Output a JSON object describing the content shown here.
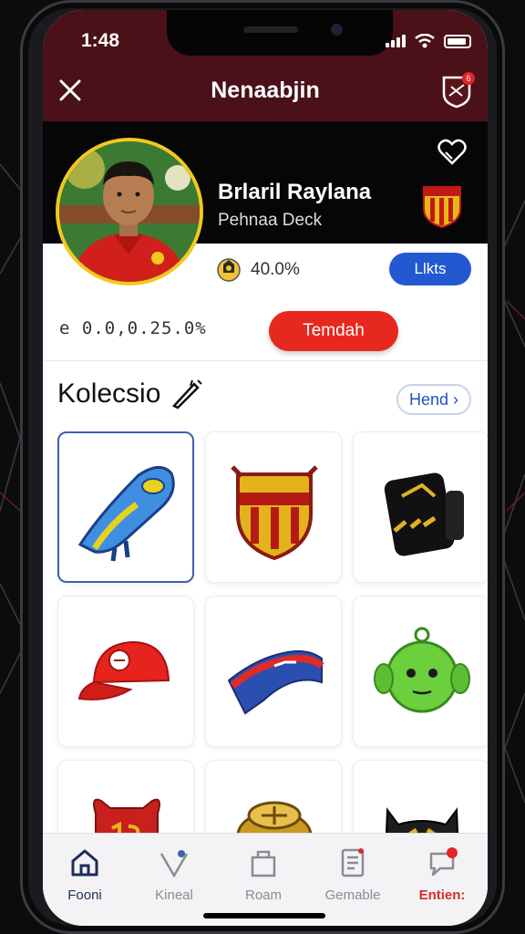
{
  "status_bar": {
    "time": "1:48"
  },
  "header": {
    "title": "Nenaabjin",
    "close_icon": "close-icon",
    "club_icon": "club-badge-icon",
    "badge_count": "6"
  },
  "profile": {
    "name": "Brlaril Raylana",
    "subtitle": "Pehnaa Deck",
    "stat_value": "40.0%",
    "likes_label": "Llkts",
    "price": "е 0.0,0.25.0%",
    "buy_label": "Temdah"
  },
  "collection": {
    "title": "Kolecsio",
    "more_label": "Hend",
    "items": [
      {
        "name": "blue-boot-icon",
        "selected": true
      },
      {
        "name": "crest-shield-icon",
        "selected": false
      },
      {
        "name": "armband-icon",
        "selected": false
      },
      {
        "name": "red-cap-icon",
        "selected": false
      },
      {
        "name": "scarf-icon",
        "selected": false
      },
      {
        "name": "green-mascot-icon",
        "selected": false
      },
      {
        "name": "red-trophy-icon",
        "selected": false
      },
      {
        "name": "gold-ring-icon",
        "selected": false
      },
      {
        "name": "black-mask-icon",
        "selected": false
      }
    ]
  },
  "tabbar": {
    "tabs": [
      {
        "label": "Fooni",
        "icon": "home-icon",
        "active": true
      },
      {
        "label": "Kineal",
        "icon": "heart-pin-icon",
        "active": false
      },
      {
        "label": "Roam",
        "icon": "bag-icon",
        "active": false
      },
      {
        "label": "Gemable",
        "icon": "document-icon",
        "active": false
      },
      {
        "label": "Entien:",
        "icon": "chat-alert-icon",
        "active": false
      }
    ]
  },
  "colors": {
    "header_bg": "#4a1119",
    "accent_blue": "#2259d1",
    "buy_red": "#e7281f",
    "avatar_ring": "#f2c81e"
  }
}
